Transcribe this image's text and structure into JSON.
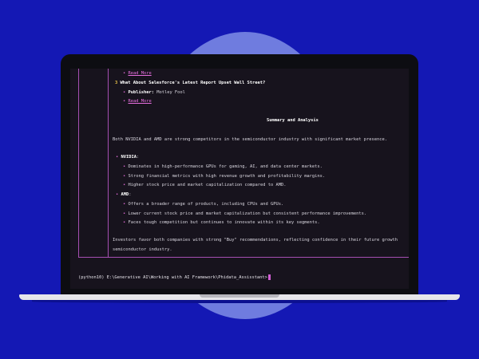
{
  "terminal": {
    "lines": {
      "read_more_1": "Read More",
      "item3_number": "3",
      "item3_title": "What About Salesforce's Latest Report Upset Wall Street?",
      "item3_publisher_label": "Publisher:",
      "item3_publisher_value": "Motley Fool",
      "read_more_2": "Read More",
      "section_heading": "Summary and Analysis",
      "intro": "Both NVIDIA and AMD are strong competitors in the semiconductor industry with significant market presence.",
      "nvidia_label": "NVIDIA",
      "nvidia_points": [
        "Dominates in high-performance GPUs for gaming, AI, and data center markets.",
        "Strong financial metrics with high revenue growth and profitability margins.",
        "Higher stock price and market capitalization compared to AMD."
      ],
      "amd_label": "AMD",
      "amd_points": [
        "Offers a broader range of products, including CPUs and GPUs.",
        "Lower current stock price and market capitalization but consistent performance improvements.",
        "Faces tough competition but continues to innovate within its key segments."
      ],
      "conclusion_1": "Investors favor both companies with strong \"Buy\" recommendations, reflecting confidence in their future growth",
      "conclusion_2": "semiconductor industry."
    },
    "prompt": "(python10) E:\\Generative AI\\Working with AI Framework\\Phidata_Assisstant>"
  },
  "colors": {
    "background": "#1418b4",
    "terminal_bg": "#17131d",
    "accent_pink": "#e86fe0",
    "panel_border": "#a64fb3"
  }
}
